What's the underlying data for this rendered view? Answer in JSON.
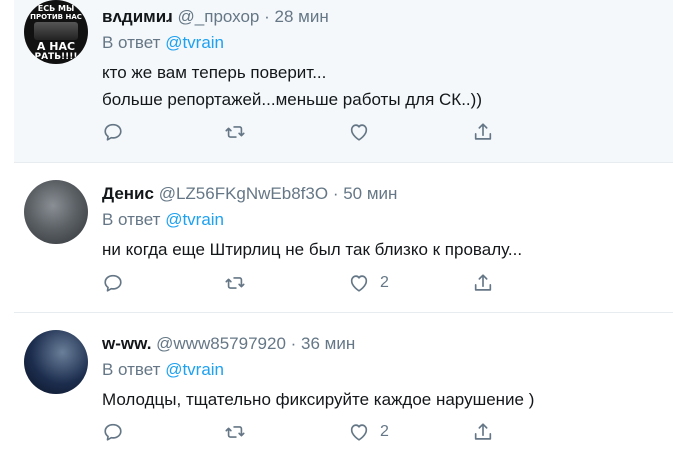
{
  "tweets": [
    {
      "name": "ʙʌдимиɹ",
      "handle": "@_прохор",
      "dot": "·",
      "time": "28 мин",
      "reply_prefix": "В ответ",
      "reply_to": "@tvrain",
      "lines": [
        "кто же вам теперь поверит...",
        "больше репортажей...меньше работы для СК..))"
      ],
      "like_count": "",
      "avatar_text": [
        "ЕСЬ МЫ",
        "ПРОТИВ НАС",
        "А НАС",
        "РАТЬ!!!!"
      ]
    },
    {
      "name": "Денис",
      "handle": "@LZ56FKgNwEb8f3O",
      "dot": "·",
      "time": "50 мин",
      "reply_prefix": "В ответ",
      "reply_to": "@tvrain",
      "lines": [
        "ни когда еще Штирлиц не был так близко к провалу..."
      ],
      "like_count": "2"
    },
    {
      "name": "w-ww.",
      "handle": "@www85797920",
      "dot": "·",
      "time": "36 мин",
      "reply_prefix": "В ответ",
      "reply_to": "@tvrain",
      "lines": [
        "Молодцы,  тщательно фиксируйте каждое нарушение )"
      ],
      "like_count": "2"
    }
  ],
  "icons": {
    "reply": "reply-icon",
    "retweet": "retweet-icon",
    "like": "heart-icon",
    "share": "share-icon"
  },
  "colors": {
    "text": "#14171a",
    "secondary": "#657786",
    "link": "#1da1f2",
    "highlight_bg": "#f5f8fa"
  }
}
